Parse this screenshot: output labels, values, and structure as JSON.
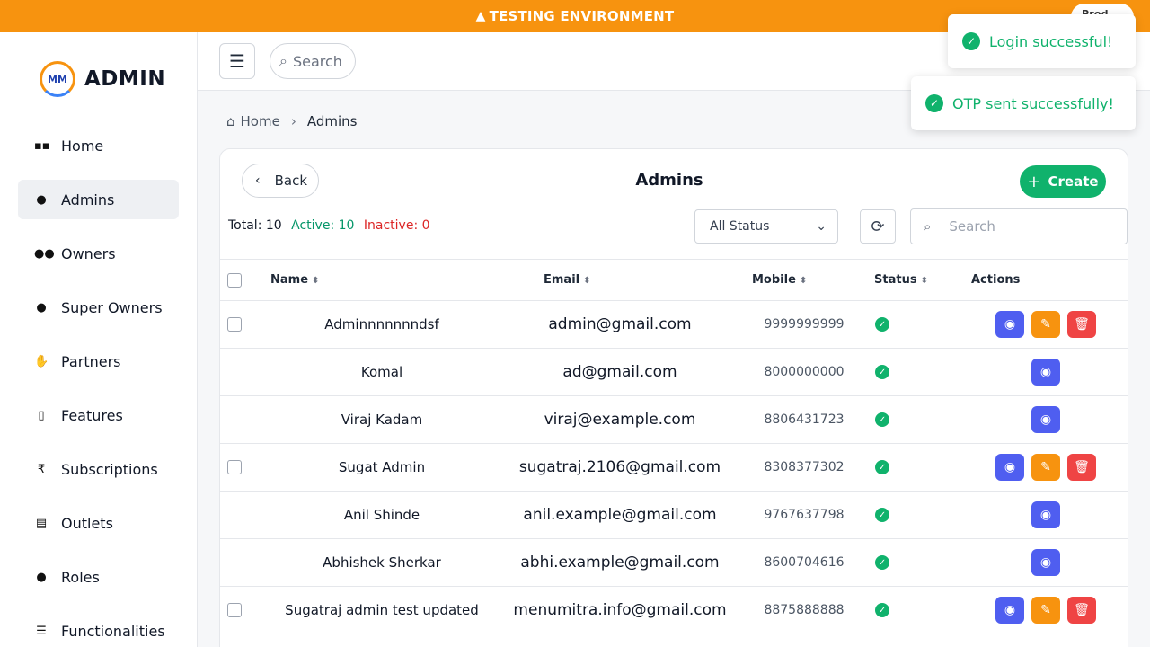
{
  "env_banner": {
    "text": "TESTING ENVIRONMENT",
    "pill": "Prod"
  },
  "brand": {
    "logo_text": "MM",
    "name": "ADMIN"
  },
  "sidebar": {
    "items": [
      {
        "label": "Home",
        "icon": "grid-icon",
        "glyph": "▪▪"
      },
      {
        "label": "Admins",
        "icon": "user-icon",
        "glyph": "●"
      },
      {
        "label": "Owners",
        "icon": "users-icon",
        "glyph": "●●"
      },
      {
        "label": "Super Owners",
        "icon": "user-gear-icon",
        "glyph": "●"
      },
      {
        "label": "Partners",
        "icon": "handshake-icon",
        "glyph": "✋"
      },
      {
        "label": "Features",
        "icon": "mobile-icon",
        "glyph": "▯"
      },
      {
        "label": "Subscriptions",
        "icon": "rupee-icon",
        "glyph": "₹"
      },
      {
        "label": "Outlets",
        "icon": "store-icon",
        "glyph": "▤"
      },
      {
        "label": "Roles",
        "icon": "user-gear-icon",
        "glyph": "●"
      },
      {
        "label": "Functionalities",
        "icon": "list-icon",
        "glyph": "☰"
      }
    ]
  },
  "topbar": {
    "search_placeholder": "Search"
  },
  "breadcrumb": {
    "home": "Home",
    "current": "Admins"
  },
  "card": {
    "back_label": "Back",
    "title": "Admins",
    "create_label": "Create"
  },
  "stats": {
    "total": "Total: 10",
    "active": "Active: 10",
    "inactive": "Inactive: 0"
  },
  "filter": {
    "status_selected": "All Status",
    "search_placeholder": "Search"
  },
  "table": {
    "headers": {
      "name": "Name",
      "email": "Email",
      "mobile": "Mobile",
      "status": "Status",
      "actions": "Actions"
    },
    "rows": [
      {
        "name": "Adminnnnnnndsf",
        "email": "admin@gmail.com",
        "mobile": "9999999999",
        "selectable": true,
        "full_actions": true
      },
      {
        "name": "Komal",
        "email": "ad@gmail.com",
        "mobile": "8000000000",
        "selectable": false,
        "full_actions": false
      },
      {
        "name": "Viraj Kadam",
        "email": "viraj@example.com",
        "mobile": "8806431723",
        "selectable": false,
        "full_actions": false
      },
      {
        "name": "Sugat Admin",
        "email": "sugatraj.2106@gmail.com",
        "mobile": "8308377302",
        "selectable": true,
        "full_actions": true
      },
      {
        "name": "Anil Shinde",
        "email": "anil.example@gmail.com",
        "mobile": "9767637798",
        "selectable": false,
        "full_actions": false
      },
      {
        "name": "Abhishek Sherkar",
        "email": "abhi.example@gmail.com",
        "mobile": "8600704616",
        "selectable": false,
        "full_actions": false
      },
      {
        "name": "Sugatraj admin test updated",
        "email": "menumitra.info@gmail.com",
        "mobile": "8875888888",
        "selectable": true,
        "full_actions": true
      }
    ]
  },
  "toasts": [
    {
      "message": "Login successful!"
    },
    {
      "message": "OTP sent successfully!"
    }
  ],
  "colors": {
    "accent": "#f7930f",
    "success": "#10b26c",
    "danger": "#ef4444",
    "view": "#4f5ef0"
  }
}
